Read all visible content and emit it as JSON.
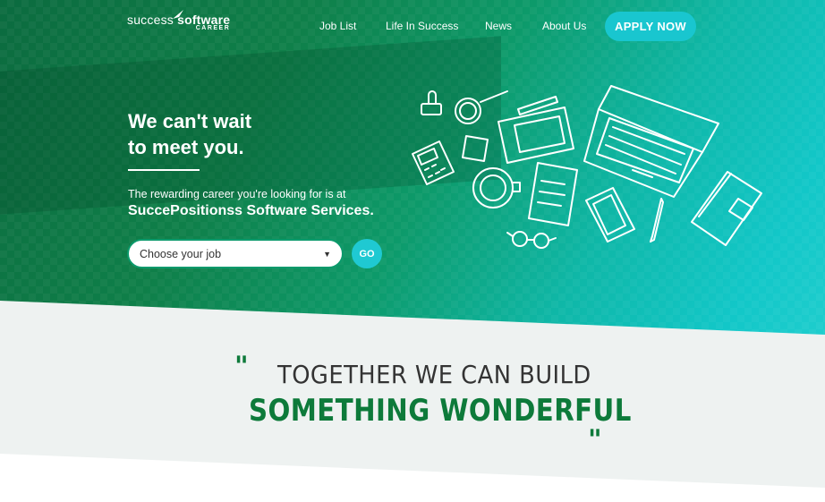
{
  "brand": {
    "logo_word1": "success",
    "logo_word2": "software",
    "logo_tagline": "CAREER"
  },
  "nav": {
    "items": [
      "Job List",
      "Life In Success",
      "News",
      "About Us"
    ],
    "apply_label": "APPLY NOW"
  },
  "hero": {
    "headline_line1": "We can't wait",
    "headline_line2": "to meet you.",
    "sub_line1": "The rewarding career you're looking for is at",
    "sub_line2": "SuccePositionss Software Services.",
    "job_select_value": "Choose your job",
    "go_label": "GO"
  },
  "quote": {
    "line1": "TOGETHER WE CAN BUILD",
    "line2": "SOMETHING WONDERFUL",
    "open_mark": "\"",
    "close_mark": "\""
  },
  "colors": {
    "brand_green": "#0d7a3a",
    "accent_teal": "#19c6cf",
    "band_bg": "#eef2f1"
  }
}
